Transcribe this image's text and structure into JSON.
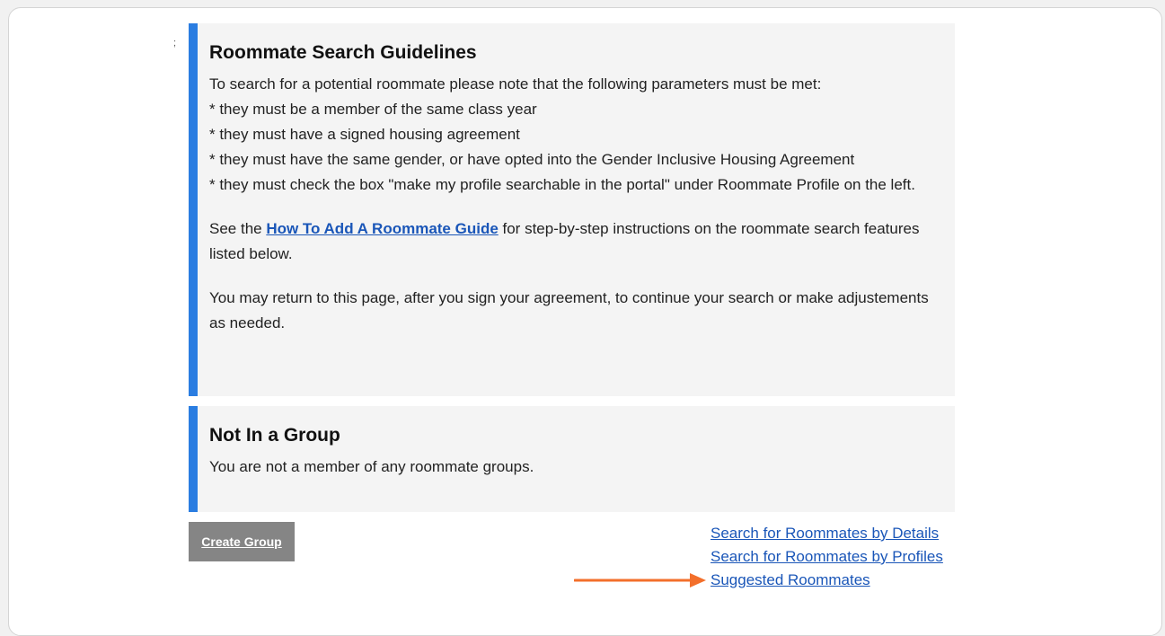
{
  "stray_mark": ";",
  "guidelines": {
    "title": "Roommate Search Guidelines",
    "intro": "To search for a potential roommate please note that the following parameters must be met:",
    "rules": [
      "* they must be a member of the same class year",
      "* they must have a signed housing agreement",
      "* they must have the same gender, or have opted into the Gender Inclusive Housing Agreement",
      "* they must check the box \"make my profile searchable in the portal\" under Roommate Profile on the left."
    ],
    "guide_prefix": "See the ",
    "guide_link": "How To Add A Roommate Guide",
    "guide_suffix": " for step-by-step instructions on the roommate search features listed below.",
    "return_note": "You may return to this page, after you sign your agreement, to continue your search or make adjustements as needed."
  },
  "group": {
    "title": "Not In a Group",
    "message": "You are not a member of any roommate groups."
  },
  "actions": {
    "create_group": "Create Group",
    "search_by_details": "Search for Roommates by Details",
    "search_by_profiles": "Search for Roommates by Profiles",
    "suggested": "Suggested Roommates"
  },
  "colors": {
    "accent_bar": "#2a7de1",
    "link": "#1a56b8",
    "annotation_arrow": "#f36f2b"
  }
}
